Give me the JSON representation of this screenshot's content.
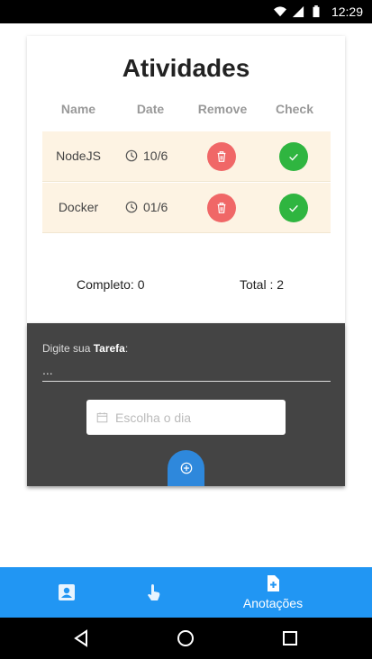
{
  "statusbar": {
    "time": "12:29"
  },
  "card": {
    "title": "Atividades",
    "columns": [
      "Name",
      "Date",
      "Remove",
      "Check"
    ],
    "rows": [
      {
        "name": "NodeJS",
        "date": "10/6"
      },
      {
        "name": "Docker",
        "date": "01/6"
      }
    ],
    "completed_label": "Completo: 0",
    "total_label": "Total : 2"
  },
  "form": {
    "label_prefix": "Digite sua ",
    "label_bold": "Tarefa",
    "label_suffix": ":",
    "task_placeholder": "...",
    "day_placeholder": "Escolha o dia"
  },
  "bottomnav": {
    "items": [
      {
        "icon": "contact-card-icon",
        "label": ""
      },
      {
        "icon": "touch-hand-icon",
        "label": ""
      },
      {
        "icon": "add-note-icon",
        "label": "Anotações"
      }
    ],
    "active_index": 2
  },
  "colors": {
    "row_bg": "#fdf3e3",
    "remove": "#f06767",
    "check": "#2fb540",
    "primary": "#2196f3",
    "panel": "#444444"
  }
}
